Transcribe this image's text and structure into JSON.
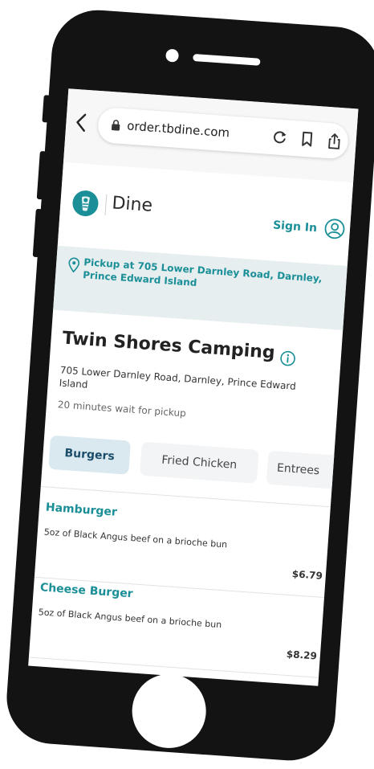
{
  "browser": {
    "url": "order.tbdine.com"
  },
  "app": {
    "brand_name": "Dine",
    "sign_in_label": "Sign In"
  },
  "pickup": {
    "text": "Pickup at 705 Lower Darnley Road, Darnley, Prince Edward Island"
  },
  "restaurant": {
    "name": "Twin Shores Camping",
    "address": "705 Lower Darnley Road, Darnley, Prince Edward Island",
    "wait_time": "20 minutes wait for pickup"
  },
  "categories": [
    {
      "label": "Burgers",
      "active": true
    },
    {
      "label": "Fried Chicken",
      "active": false
    },
    {
      "label": "Entrees",
      "active": false
    }
  ],
  "menu_items": [
    {
      "name": "Hamburger",
      "description": "5oz of Black Angus beef on a brioche bun",
      "price": "$6.79"
    },
    {
      "name": "Cheese Burger",
      "description": "5oz of Black Angus beef on a brioche bun",
      "price": "$8.29"
    }
  ],
  "colors": {
    "accent": "#1a8f97",
    "phone_body": "#131313",
    "banner_bg": "#e6eef0",
    "active_tab_bg": "#d9e9ef"
  }
}
